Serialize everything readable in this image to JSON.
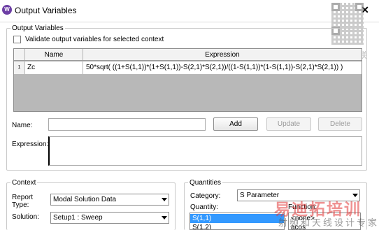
{
  "window": {
    "title": "Output Variables",
    "close": "✕"
  },
  "watermark": {
    "wechat": "微 信 联 系",
    "brand": "易迪拓培训",
    "subtitle": "射频和天线设计专家"
  },
  "output_variables": {
    "group_label": "Output Variables",
    "validate_label": "Validate output variables for selected context",
    "validate_checked": false,
    "columns": [
      "Name",
      "Expression"
    ],
    "rows": [
      {
        "index": "1",
        "name": "Zc",
        "expression": "50*sqrt( ((1+S(1,1))*(1+S(1,1))-S(2,1)*S(2,1))/((1-S(1,1))*(1-S(1,1))-S(2,1)*S(2,1)) )"
      }
    ],
    "name_label": "Name:",
    "name_value": "",
    "expression_label": "Expression:",
    "expression_value": "",
    "buttons": {
      "add": "Add",
      "update": "Update",
      "delete": "Delete"
    }
  },
  "context": {
    "group_label": "Context",
    "report_type_label": "Report Type:",
    "report_type_value": "Modal Solution Data",
    "solution_label": "Solution:",
    "solution_value": "Setup1 : Sweep"
  },
  "quantities": {
    "group_label": "Quantities",
    "category_label": "Category:",
    "category_value": "S Parameter",
    "quantity_label": "Quantity:",
    "quantity_items": [
      "S(1,1)",
      "S(1,2)"
    ],
    "selected_quantity": "S(1,1)",
    "function_label": "Function:",
    "function_items": [
      "<none>",
      "acos"
    ]
  },
  "colors": {
    "selection": "#3399ff",
    "grid_background": "#b8b8b8",
    "watermark_red": "#e23a3a"
  }
}
